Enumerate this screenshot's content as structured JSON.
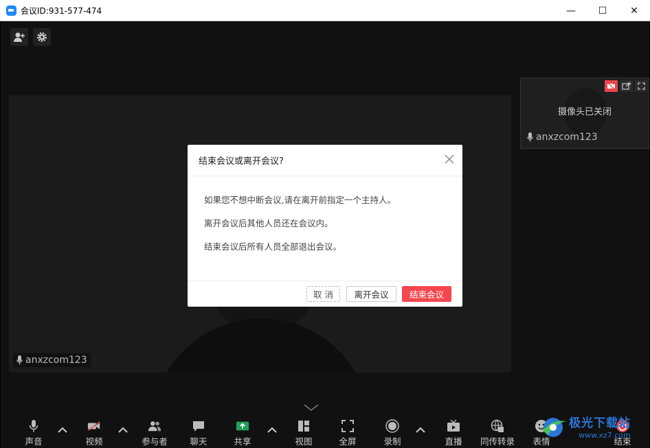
{
  "window": {
    "title": "会议ID:931-577-474",
    "minimize_glyph": "—",
    "maximize_glyph": "☐",
    "close_glyph": "✕"
  },
  "top_icons": [
    "add-user-icon",
    "gear-icon"
  ],
  "main_video": {
    "participant_name": "anxzcom123"
  },
  "thumbnail": {
    "status_text": "摄像头已关闭",
    "participant_name": "anxzcom123"
  },
  "dialog": {
    "title": "结束会议或离开会议?",
    "lines": [
      "如果您不想中断会议,请在离开前指定一个主持人。",
      "离开会议后其他人员还在会议内。",
      "结束会议后所有人员全部退出会议。"
    ],
    "buttons": {
      "cancel": "取 消",
      "leave": "离开会议",
      "end": "结束会议"
    },
    "accent_color": "#f5474f"
  },
  "toolbar": {
    "items": [
      {
        "label": "声音",
        "icon": "microphone-icon"
      },
      {
        "label": "视频",
        "icon": "video-off-icon"
      },
      {
        "label": "参与者",
        "icon": "participants-icon"
      },
      {
        "label": "聊天",
        "icon": "chat-icon"
      },
      {
        "label": "共享",
        "icon": "share-icon"
      },
      {
        "label": "视图",
        "icon": "layout-icon"
      },
      {
        "label": "全屏",
        "icon": "fullscreen-icon"
      },
      {
        "label": "录制",
        "icon": "record-icon"
      },
      {
        "label": "直播",
        "icon": "live-icon"
      },
      {
        "label": "同传转录",
        "icon": "translate-icon"
      },
      {
        "label": "表情",
        "icon": "emoji-icon"
      },
      {
        "label": "结束",
        "icon": "end-icon"
      }
    ]
  },
  "watermark": {
    "title": "极光下载站",
    "url": "www.xz7.com"
  }
}
